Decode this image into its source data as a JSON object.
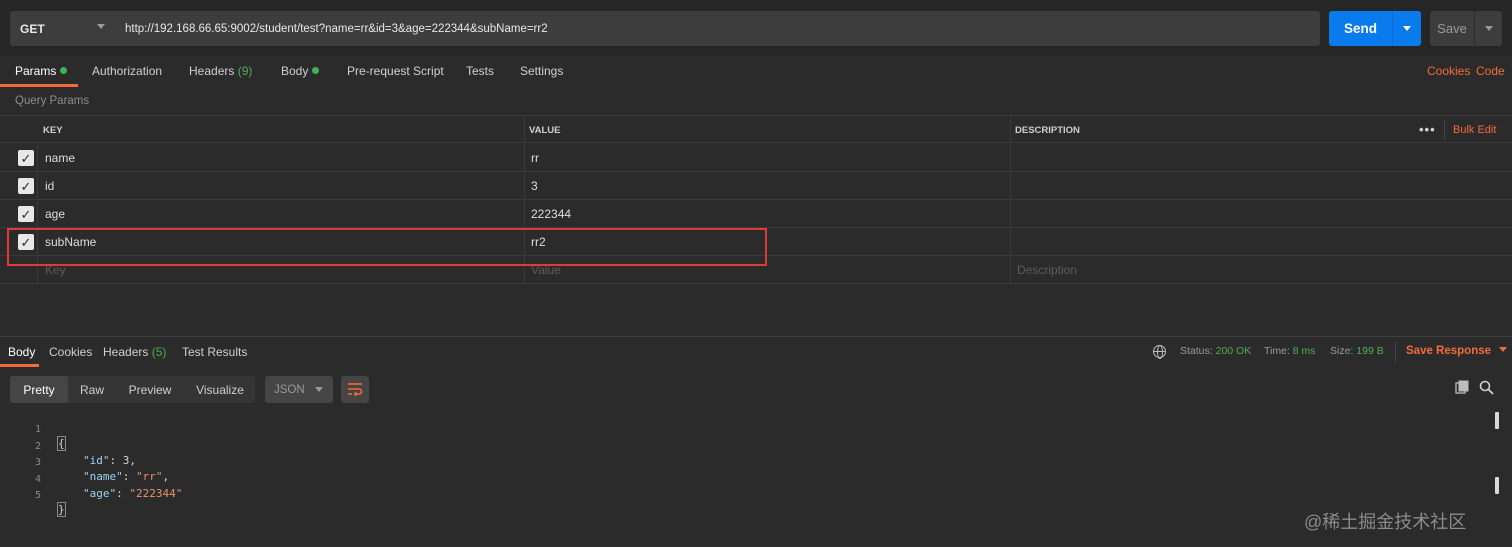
{
  "request": {
    "method": "GET",
    "url": "http://192.168.66.65:9002/student/test?name=rr&id=3&age=222344&subName=rr2",
    "send_label": "Send",
    "save_label": "Save"
  },
  "request_tabs": {
    "params": "Params",
    "authorization": "Authorization",
    "headers": "Headers",
    "headers_count": "(9)",
    "body": "Body",
    "pre_request": "Pre-request Script",
    "tests": "Tests",
    "settings": "Settings",
    "cookies": "Cookies",
    "code": "Code"
  },
  "query_params": {
    "title": "Query Params",
    "columns": {
      "key": "KEY",
      "value": "VALUE",
      "description": "DESCRIPTION"
    },
    "more": "•••",
    "bulk_edit": "Bulk Edit",
    "rows": [
      {
        "key": "name",
        "value": "rr",
        "description": "",
        "checked": true
      },
      {
        "key": "id",
        "value": "3",
        "description": "",
        "checked": true
      },
      {
        "key": "age",
        "value": "222344",
        "description": "",
        "checked": true
      },
      {
        "key": "subName",
        "value": "rr2",
        "description": "",
        "checked": true
      }
    ],
    "placeholders": {
      "key": "Key",
      "value": "Value",
      "description": "Description"
    }
  },
  "response_tabs": {
    "body": "Body",
    "cookies": "Cookies",
    "headers": "Headers",
    "headers_count": "(5)",
    "test_results": "Test Results"
  },
  "response_status": {
    "status_label": "Status:",
    "status_value": "200 OK",
    "time_label": "Time:",
    "time_value": "8 ms",
    "size_label": "Size:",
    "size_value": "199 B",
    "save_response": "Save Response"
  },
  "view_options": {
    "pretty": "Pretty",
    "raw": "Raw",
    "preview": "Preview",
    "visualize": "Visualize",
    "format": "JSON"
  },
  "response_body": {
    "line_numbers": [
      "1",
      "2",
      "3",
      "4",
      "5"
    ],
    "open_brace": "{",
    "close_brace": "}",
    "id_key": "\"id\"",
    "id_value": "3",
    "name_key": "\"name\"",
    "name_value": "\"rr\"",
    "age_key": "\"age\"",
    "age_value": "\"222344\""
  },
  "watermark": "@稀土掘金技术社区",
  "colors": {
    "accent": "#f26b3a",
    "send": "#097bed",
    "status_ok": "#4caf50",
    "highlight_box": "#e0393b"
  }
}
